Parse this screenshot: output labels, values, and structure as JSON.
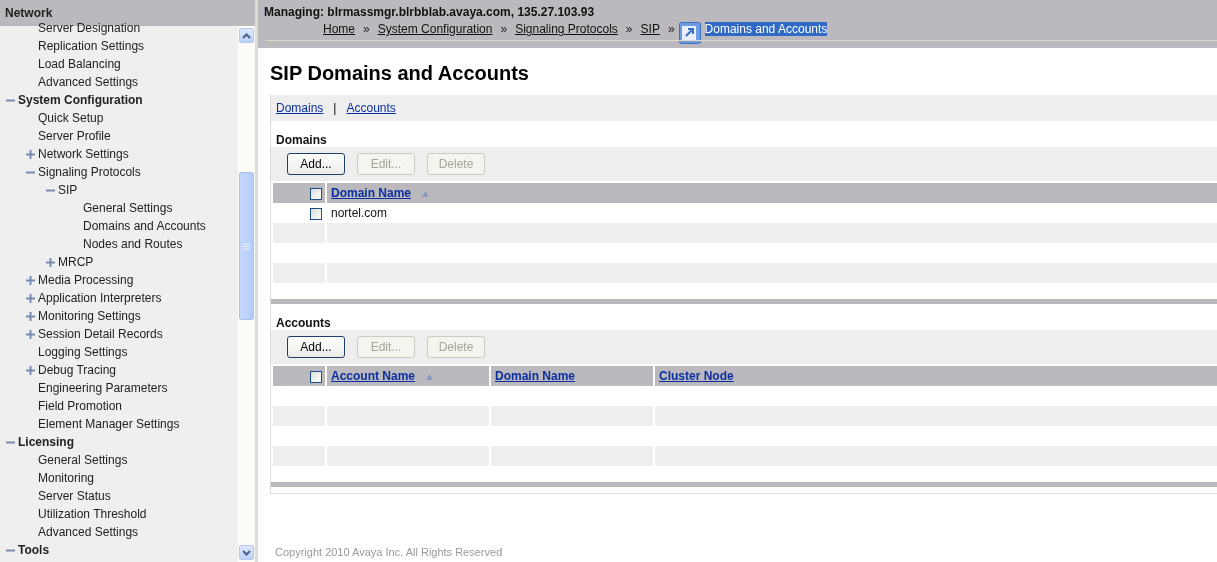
{
  "sidebar": {
    "title": "Network",
    "items": [
      {
        "kind": "continued",
        "children": [
          {
            "label": "Server Designation"
          },
          {
            "label": "Replication Settings"
          },
          {
            "label": "Load Balancing"
          },
          {
            "label": "Advanced Settings"
          }
        ]
      },
      {
        "label": "System Configuration",
        "expanded": true,
        "children": [
          {
            "label": "Quick Setup"
          },
          {
            "label": "Server Profile"
          },
          {
            "label": "Network Settings",
            "expanded": false
          },
          {
            "label": "Signaling Protocols",
            "expanded": true,
            "children": [
              {
                "label": "SIP",
                "expanded": true,
                "children": [
                  {
                    "label": "General Settings",
                    "selected": false
                  },
                  {
                    "label": "Domains and Accounts",
                    "selected": false
                  },
                  {
                    "label": "Nodes and Routes",
                    "selected": false
                  }
                ]
              },
              {
                "label": "MRCP",
                "expanded": false
              }
            ]
          },
          {
            "label": "Media Processing",
            "expanded": false
          },
          {
            "label": "Application Interpreters",
            "expanded": false
          },
          {
            "label": "Monitoring Settings",
            "expanded": false
          },
          {
            "label": "Session Detail Records",
            "expanded": false
          },
          {
            "label": "Logging Settings"
          },
          {
            "label": "Debug Tracing",
            "expanded": false
          },
          {
            "label": "Engineering Parameters"
          },
          {
            "label": "Field Promotion"
          },
          {
            "label": "Element Manager Settings"
          }
        ]
      },
      {
        "label": "Licensing",
        "expanded": true,
        "children": [
          {
            "label": "General Settings"
          },
          {
            "label": "Monitoring"
          },
          {
            "label": "Server Status"
          },
          {
            "label": "Utilization Threshold"
          },
          {
            "label": "Advanced Settings"
          }
        ]
      },
      {
        "label": "Tools",
        "expanded": true
      }
    ]
  },
  "header": {
    "managing": "Managing: blrmassmgr.blrbblab.avaya.com, 135.27.103.93",
    "breadcrumb": [
      {
        "kind": "link",
        "label": "Home"
      },
      {
        "kind": "sep",
        "label": "»"
      },
      {
        "kind": "link",
        "label": "System Configuration"
      },
      {
        "kind": "sep",
        "label": "»"
      },
      {
        "kind": "link",
        "label": "Signaling Protocols"
      },
      {
        "kind": "sep",
        "label": "»"
      },
      {
        "kind": "link",
        "label": "SIP"
      },
      {
        "kind": "sep",
        "label": "»"
      },
      {
        "kind": "current",
        "label": "Domains and Accounts"
      }
    ]
  },
  "page_title": "SIP Domains and Accounts",
  "section_links": [
    {
      "kind": "link",
      "label": "Domains"
    },
    {
      "kind": "sep",
      "label": "|"
    },
    {
      "kind": "link",
      "label": "Accounts"
    }
  ],
  "sections": [
    {
      "title": "Domains",
      "buttons": [
        {
          "label": "Add...",
          "disabled": false
        },
        {
          "label": "Edit...",
          "disabled": true
        },
        {
          "label": "Delete",
          "disabled": true
        }
      ],
      "select_all_checked": false,
      "columns": [
        {
          "label": "Domain Name",
          "sorted": true
        }
      ],
      "rows": [
        {
          "checked": false,
          "cells": [
            "nortel.com"
          ]
        },
        {
          "cells": []
        },
        {
          "cells": []
        },
        {
          "cells": []
        }
      ]
    },
    {
      "title": "Accounts",
      "buttons": [
        {
          "label": "Add...",
          "disabled": false
        },
        {
          "label": "Edit...",
          "disabled": true
        },
        {
          "label": "Delete",
          "disabled": true
        }
      ],
      "select_all_checked": false,
      "columns": [
        {
          "label": "Account Name",
          "sorted": true
        },
        {
          "label": "Domain Name",
          "sorted": false
        },
        {
          "label": "Cluster Node",
          "sorted": false
        }
      ],
      "rows": [
        {
          "cells": []
        },
        {
          "cells": []
        },
        {
          "cells": []
        },
        {
          "cells": []
        }
      ]
    }
  ],
  "footer": "Copyright 2010 Avaya Inc. All Rights Reserved"
}
